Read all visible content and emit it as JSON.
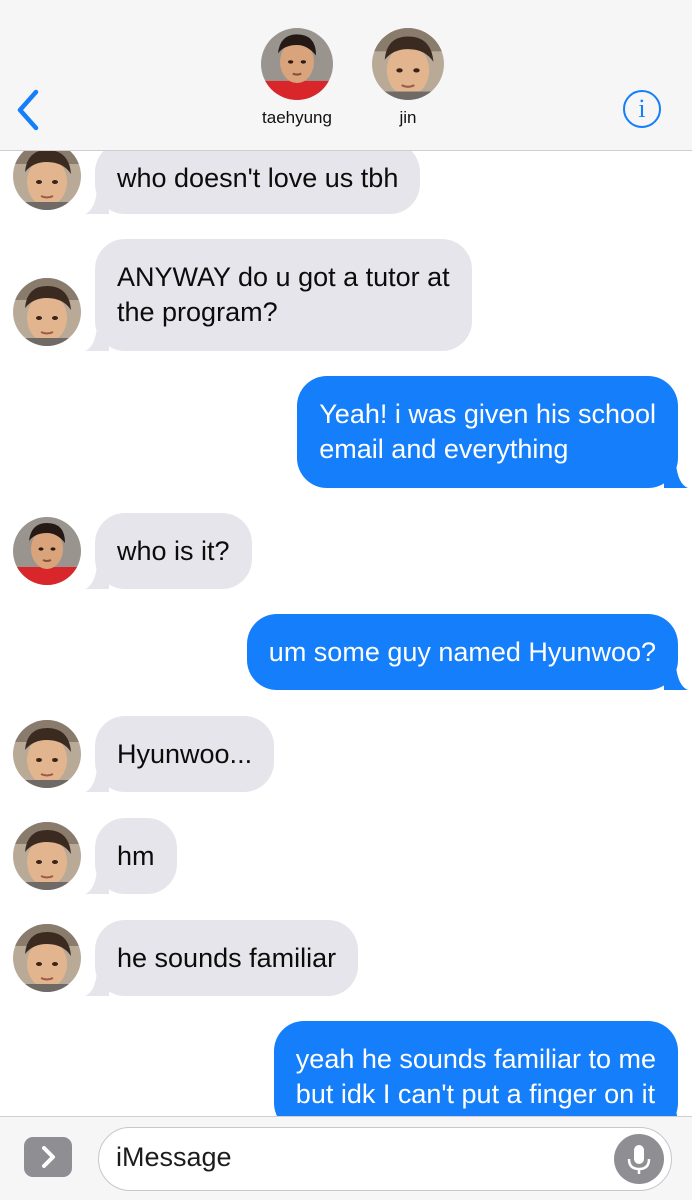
{
  "header": {
    "contacts": [
      {
        "name": "taehyung",
        "avatar_icon": "avatar-photo-taehyung"
      },
      {
        "name": "jin",
        "avatar_icon": "avatar-photo-jin"
      }
    ],
    "back_icon": "chevron-left-icon",
    "info_label": "i"
  },
  "colors": {
    "accent": "#157efb",
    "incoming_bubble": "#e6e5eb",
    "outgoing_text": "#ffffff"
  },
  "messages": [
    {
      "from": "jin",
      "direction": "incoming",
      "text": "who doesn't love us tbh"
    },
    {
      "from": "jin",
      "direction": "incoming",
      "text": "ANYWAY do u got a tutor at\nthe program?"
    },
    {
      "from": "me",
      "direction": "outgoing",
      "text": "Yeah! i was given his school\nemail and everything"
    },
    {
      "from": "taehyung",
      "direction": "incoming",
      "text": "who is it?"
    },
    {
      "from": "me",
      "direction": "outgoing",
      "text": "um some guy named Hyunwoo?"
    },
    {
      "from": "jin",
      "direction": "incoming",
      "text": "Hyunwoo..."
    },
    {
      "from": "jin",
      "direction": "incoming",
      "text": "hm"
    },
    {
      "from": "jin",
      "direction": "incoming",
      "text": "he sounds familiar"
    },
    {
      "from": "me",
      "direction": "outgoing",
      "text": "yeah he sounds familiar to me\nbut idk I can't put a finger on it"
    }
  ],
  "composer": {
    "placeholder": "iMessage",
    "expand_icon": "chevron-right-icon",
    "mic_icon": "microphone-icon"
  }
}
